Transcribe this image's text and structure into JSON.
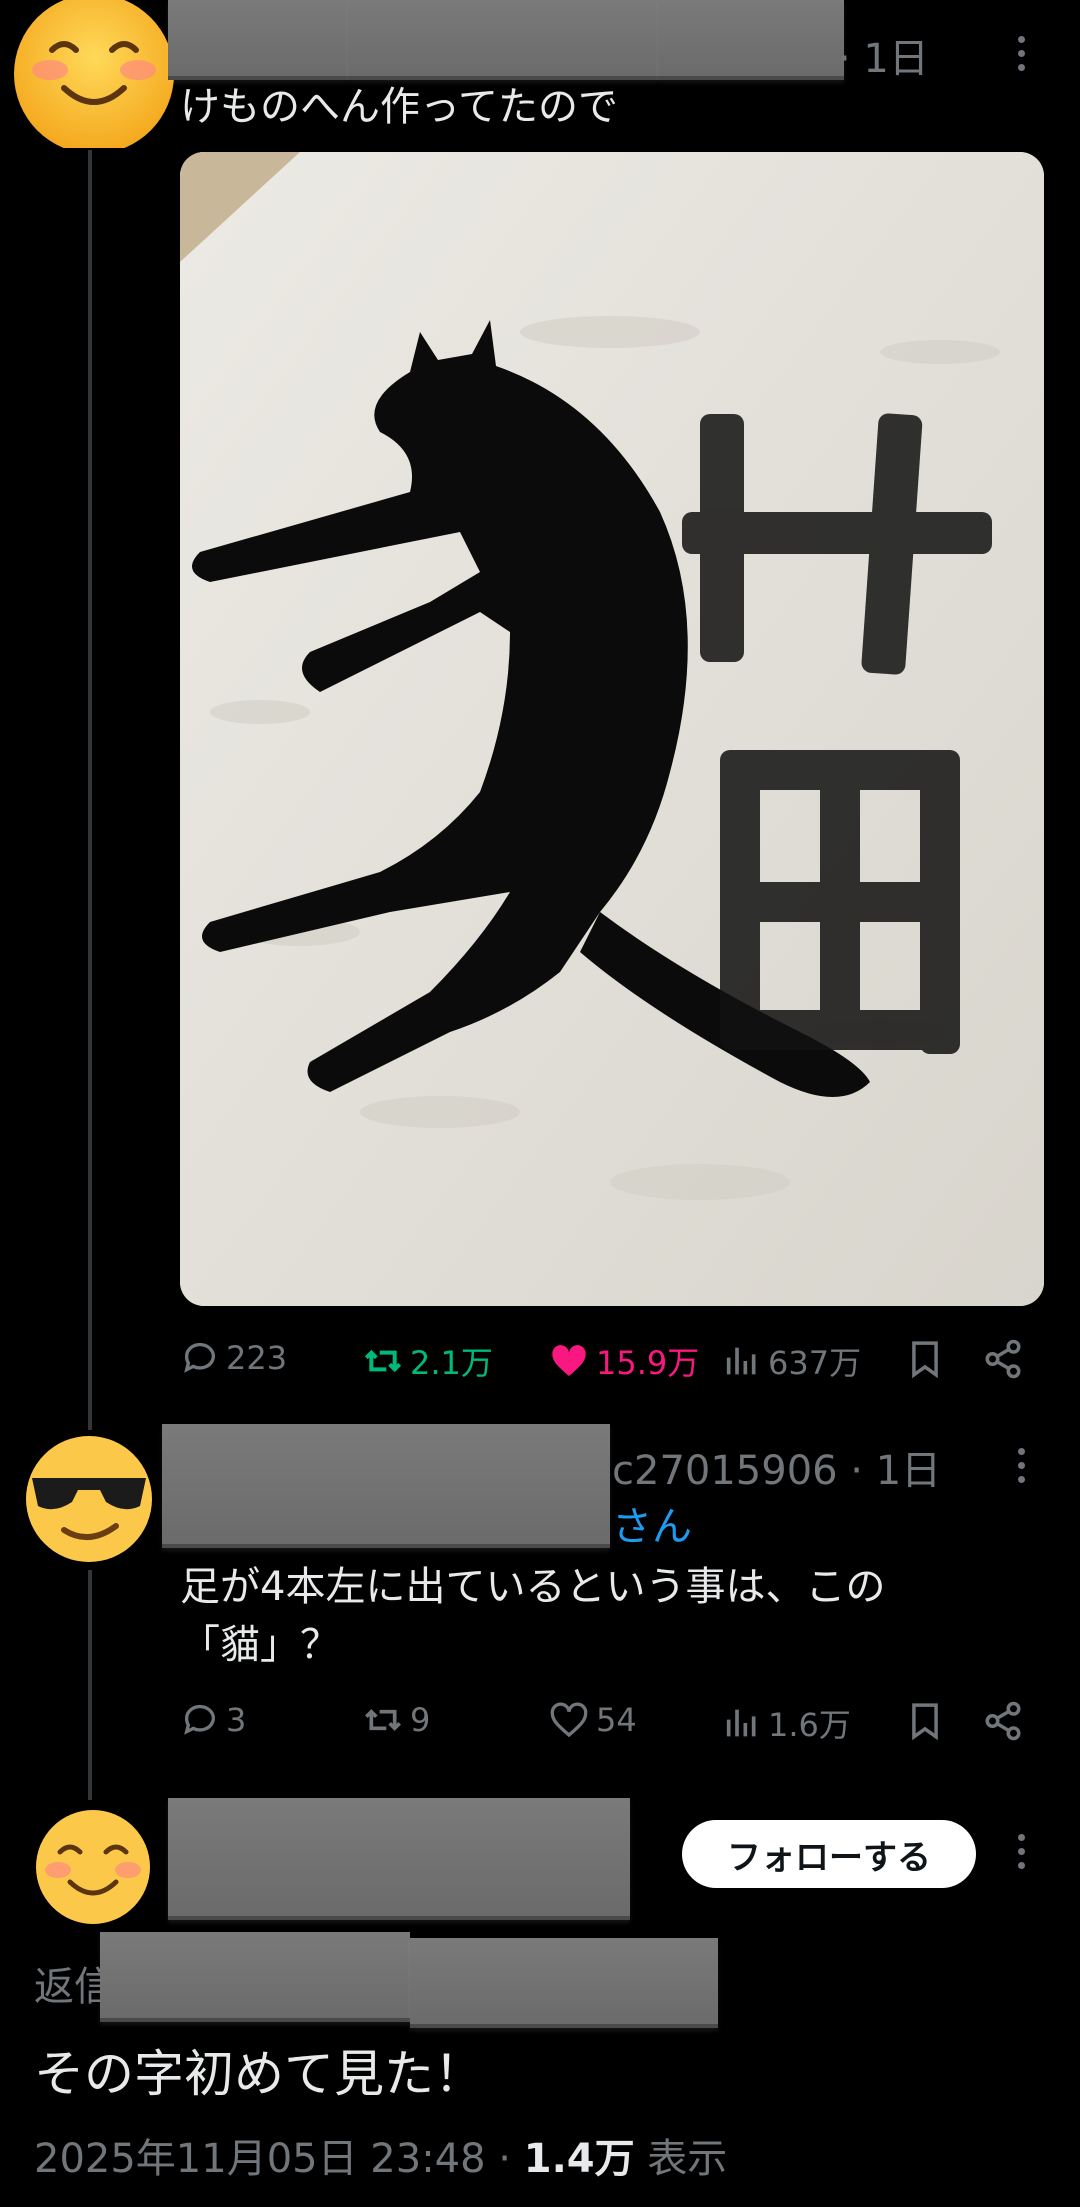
{
  "post1": {
    "time": "· 1日",
    "text": "けものへん作ってたので",
    "image_kanji_top": "艹",
    "image_kanji_bottom": "田",
    "actions": {
      "replies": "223",
      "reposts": "2.1万",
      "likes": "15.9万",
      "views": "637万"
    }
  },
  "post2": {
    "handle_fragment": "c27015906 · 1日",
    "replying_to_suffix": "さん",
    "text": "足が4本左に出ているという事は、この「貓」？",
    "actions": {
      "replies": "3",
      "reposts": "9",
      "likes": "54",
      "views": "1.6万"
    }
  },
  "post3": {
    "follow_label": "フォローする",
    "reply_prefix": "返信",
    "text": "その字初めて見た！",
    "timestamp": "2025年11月05日 23:48 · ",
    "views_count": "1.4万",
    "views_label": " 表示"
  },
  "colors": {
    "background": "#000000",
    "text": "#e7e9ea",
    "muted": "#71767b",
    "repost_active": "#00ba7c",
    "like_active": "#f91880",
    "link": "#1d9bf0"
  },
  "icons": [
    "reply-icon",
    "repost-icon",
    "like-icon",
    "views-icon",
    "bookmark-icon",
    "share-icon",
    "more-icon"
  ]
}
